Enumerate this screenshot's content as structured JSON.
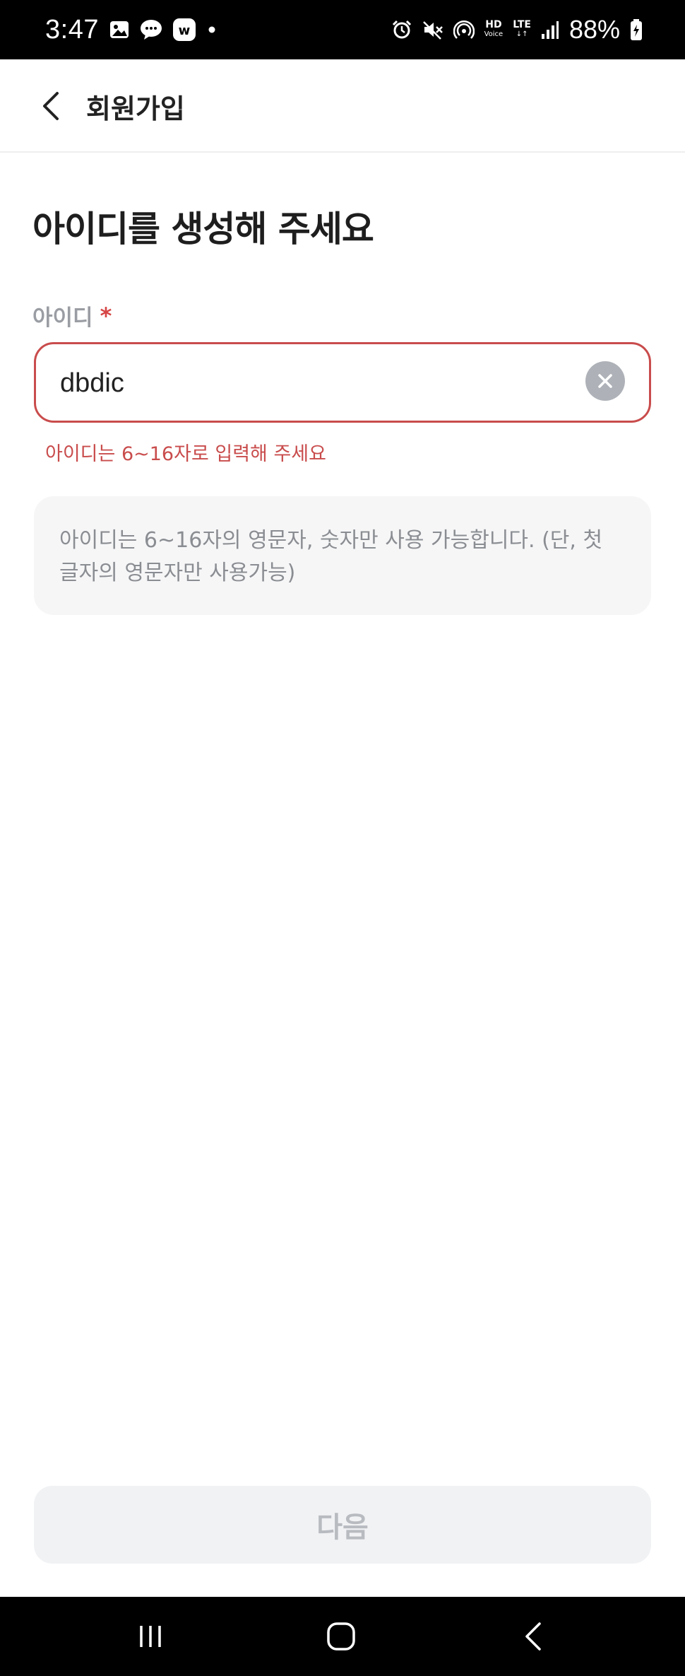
{
  "status_bar": {
    "time": "3:47",
    "left_icons": [
      "gallery-icon",
      "chat-bubble-icon",
      "w-app-icon",
      "dot-icon"
    ],
    "right_icons": [
      "alarm-icon",
      "mute-icon",
      "hotspot-icon",
      "hd-voice-icon",
      "lte-icon",
      "signal-icon",
      "battery-icon"
    ],
    "hd_label": "HD",
    "voice_label": "Voice",
    "lte_label": "LTE",
    "battery": "88%"
  },
  "header": {
    "title": "회원가입"
  },
  "main": {
    "page_title": "아이디를 생성해 주세요",
    "field_label": "아이디",
    "required_mark": "*",
    "id_value": "dbdic",
    "error_message": "아이디는 6~16자로 입력해 주세요",
    "info_text": "아이디는 6~16자의 영문자, 숫자만 사용 가능합니다. (단, 첫 글자의 영문자만 사용가능)"
  },
  "footer": {
    "next_label": "다음"
  },
  "nav_bar": {
    "buttons": [
      "recent-apps-icon",
      "home-icon",
      "back-icon"
    ]
  },
  "colors": {
    "error": "#c94c4c",
    "required": "#d64545",
    "label_gray": "#9a9da3",
    "disabled_button_bg": "#f1f2f4",
    "disabled_button_text": "#b8bbc0"
  }
}
